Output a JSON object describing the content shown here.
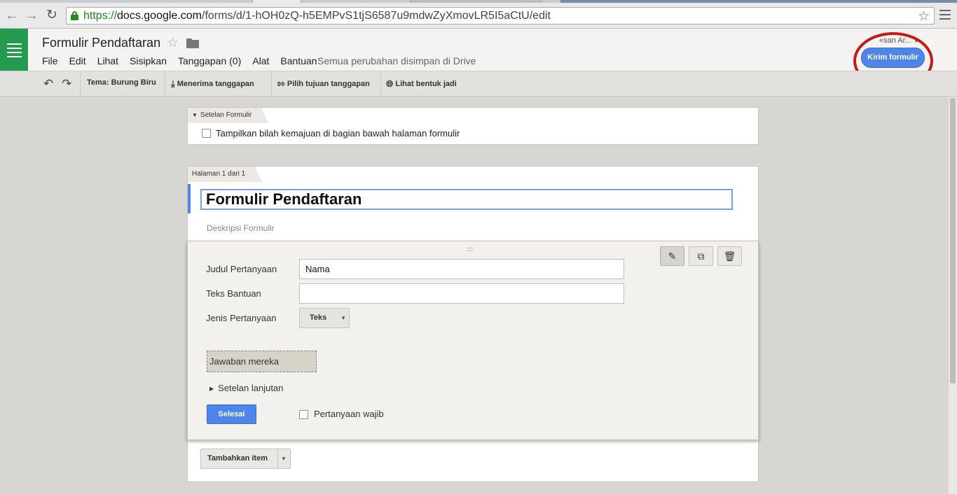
{
  "browser": {
    "url_scheme": "https://",
    "url_host": "docs.google.com",
    "url_path": "/forms/d/1-hOH0zQ-h5EMPvS1tjS6587u9mdwZyXmovLR5I5aCtU/edit",
    "back_icon": "back-arrow-icon",
    "forward_icon": "forward-arrow-icon",
    "reload_icon": "reload-icon",
    "lock_icon": "lock-icon",
    "bookmark_icon": "star-icon",
    "menu_icon": "hamburger-menu-icon"
  },
  "header": {
    "title": "Formulir Pendaftaran",
    "menu": [
      "File",
      "Edit",
      "Lihat",
      "Sisipkan",
      "Tanggapan (0)",
      "Alat",
      "Bantuan"
    ],
    "save_status": "Semua perubahan disimpan di Drive",
    "account": "«san Ar...",
    "send_button": "Kirim formulir",
    "annotation_color": "#c41a1a",
    "brand_color": "#249b4f",
    "accent_color": "#4d86e8"
  },
  "toolbar": {
    "theme": "Tema: Burung Biru",
    "receive_responses": "Menerima tanggapan",
    "choose_destination": "Pilih tujuan tanggapan",
    "view_live": "Lihat bentuk jadi"
  },
  "settings": {
    "tab_label": "Setelan Formulir",
    "progress_bar_label": "Tampilkan bilah kemajuan di bagian bawah halaman formulir",
    "progress_bar_checked": false
  },
  "page": {
    "tab_label": "Halaman 1 dari 1",
    "form_title": "Formulir Pendaftaran",
    "description_placeholder": "Deskripsi Formulir"
  },
  "question": {
    "title_label": "Judul Pertanyaan",
    "title_value": "Nama",
    "help_label": "Teks Bantuan",
    "help_value": "",
    "type_label": "Jenis Pertanyaan",
    "type_value": "Teks",
    "answer_preview": "Jawaban mereka",
    "advanced": "Setelan lanjutan",
    "done": "Selesai",
    "required_label": "Pertanyaan wajib",
    "required_checked": false
  },
  "add_item": {
    "label": "Tambahkan item"
  }
}
